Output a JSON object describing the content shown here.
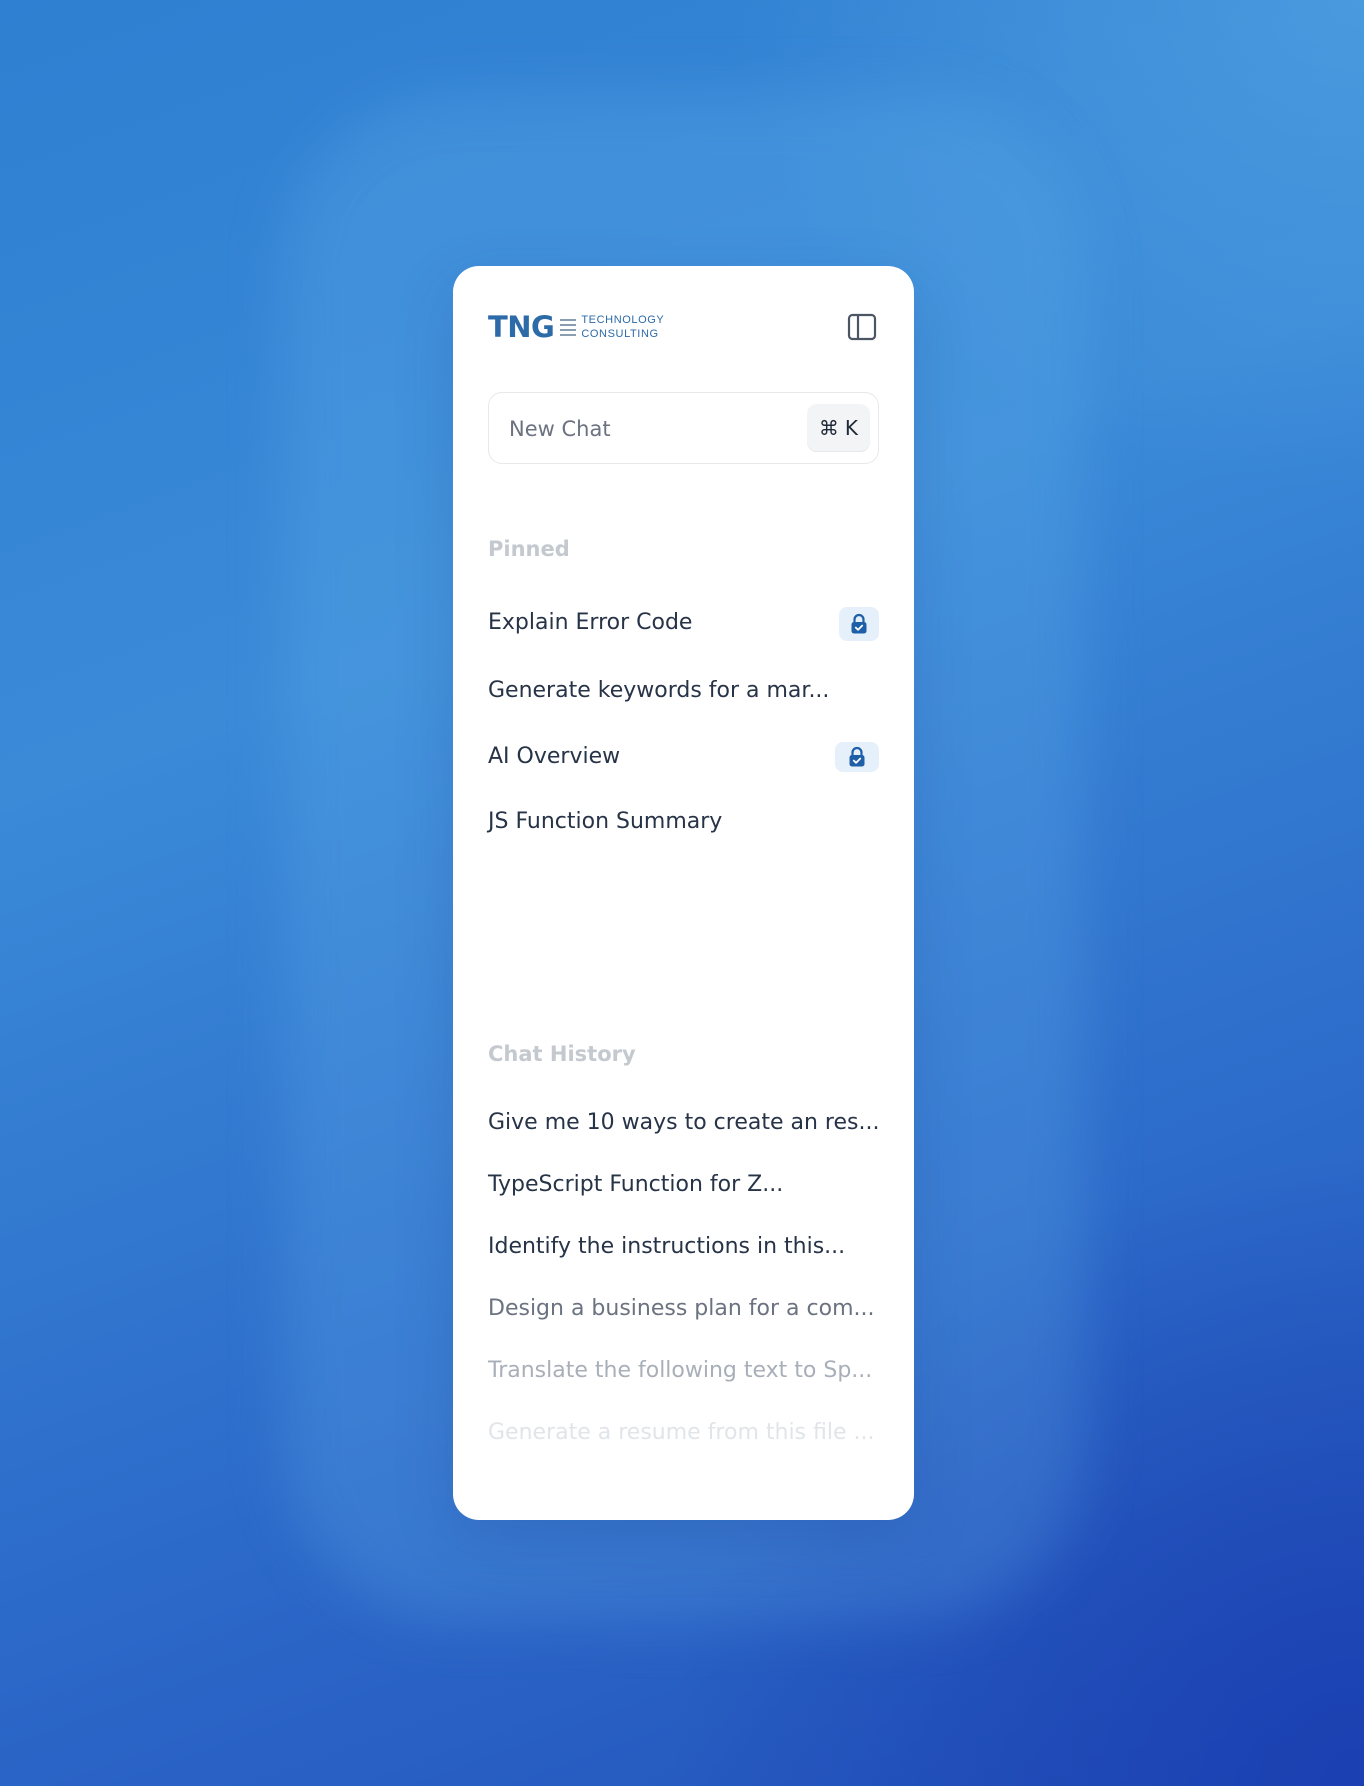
{
  "brand": {
    "mark": "TNG",
    "line1": "TECHNOLOGY",
    "line2": "CONSULTING"
  },
  "icons": {
    "sidebar_toggle": "sidebar-panel-icon",
    "command": "command-key-icon",
    "lock": "lock-icon"
  },
  "new_chat": {
    "label": "New Chat",
    "shortcut_symbol": "⌘",
    "shortcut_key": "K"
  },
  "pinned": {
    "title": "Pinned",
    "items": [
      {
        "label": "Explain Error Code",
        "locked": true
      },
      {
        "label": "Generate keywords for a mar...",
        "locked": false
      },
      {
        "label": "AI Overview",
        "locked": true
      },
      {
        "label": "JS Function Summary",
        "locked": false
      }
    ]
  },
  "history": {
    "title": "Chat History",
    "items": [
      {
        "label": "Give me 10 ways to create an res..."
      },
      {
        "label": "TypeScript Function for Z..."
      },
      {
        "label": "Identify the instructions in this..."
      },
      {
        "label": "Design a business plan for a com..."
      },
      {
        "label": "Translate the following text to Sp..."
      },
      {
        "label": "Generate a resume from this file ..."
      }
    ]
  },
  "colors": {
    "brand_blue": "#2c6aa8",
    "accent_blue": "#1f5fa8",
    "lock_bg": "#e6f0fa",
    "text_primary": "#273347",
    "section_label": "#c4c9d0"
  }
}
